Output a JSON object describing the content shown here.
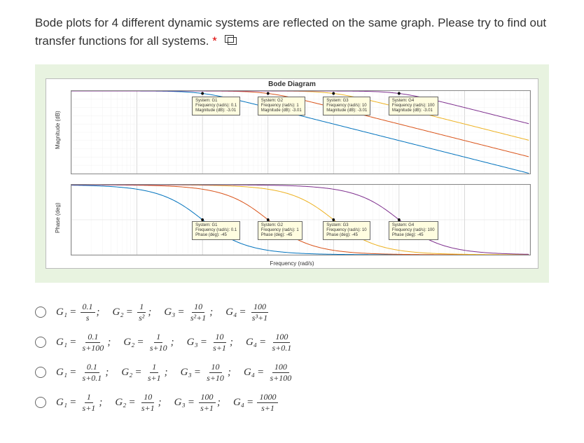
{
  "question": {
    "text": "Bode plots for 4 different dynamic systems are reflected on the same graph. Please try to find out transfer functions for all systems.",
    "required_mark": "*"
  },
  "chart_data": {
    "type": "line",
    "title": "Bode Diagram",
    "xlabel": "Frequency (rad/s)",
    "xscale": "log",
    "xrange": [
      0.001,
      10000
    ],
    "subplots": [
      {
        "ylabel": "Magnitude (dB)",
        "ylim": [
          -100,
          0
        ],
        "yticks": [
          -10,
          -20,
          -30,
          -40,
          -50,
          -60,
          -70,
          -80,
          -90,
          -100
        ],
        "series": [
          {
            "name": "G1",
            "color": "#0072bd",
            "break_freq": 0.1
          },
          {
            "name": "G2",
            "color": "#d95319",
            "break_freq": 1
          },
          {
            "name": "G3",
            "color": "#edb120",
            "break_freq": 10
          },
          {
            "name": "G4",
            "color": "#7e2f8e",
            "break_freq": 100
          }
        ],
        "tooltips": [
          {
            "system": "G1",
            "freq": "0.1",
            "mag": "-3.01"
          },
          {
            "system": "G2",
            "freq": "1",
            "mag": "-3.01"
          },
          {
            "system": "G3",
            "freq": "10",
            "mag": "-3.01"
          },
          {
            "system": "G4",
            "freq": "100",
            "mag": "-3.01"
          }
        ]
      },
      {
        "ylabel": "Phase (deg)",
        "ylim": [
          -90,
          0
        ],
        "yticks": [
          0,
          -45,
          -90
        ],
        "series": [
          {
            "name": "G1",
            "color": "#0072bd",
            "break_freq": 0.1
          },
          {
            "name": "G2",
            "color": "#d95319",
            "break_freq": 1
          },
          {
            "name": "G3",
            "color": "#edb120",
            "break_freq": 10
          },
          {
            "name": "G4",
            "color": "#7e2f8e",
            "break_freq": 100
          }
        ],
        "tooltips": [
          {
            "system": "G1",
            "freq": "0.1",
            "phase": "-45"
          },
          {
            "system": "G2",
            "freq": "1",
            "phase": "-45"
          },
          {
            "system": "G3",
            "freq": "10",
            "phase": "-45"
          },
          {
            "system": "G4",
            "freq": "100",
            "phase": "-45"
          }
        ]
      }
    ]
  },
  "options": [
    {
      "terms": [
        {
          "label": "G₁",
          "num": "0.1",
          "den": "s"
        },
        {
          "label": "G₂",
          "num": "1",
          "den": "s²"
        },
        {
          "label": "G₃",
          "num": "10",
          "den": "s²+1"
        },
        {
          "label": "G₄",
          "num": "100",
          "den": "s³+1"
        }
      ]
    },
    {
      "terms": [
        {
          "label": "G₁",
          "num": "0.1",
          "den": "s+100"
        },
        {
          "label": "G₂",
          "num": "1",
          "den": "s+10"
        },
        {
          "label": "G₃",
          "num": "10",
          "den": "s+1"
        },
        {
          "label": "G₄",
          "num": "100",
          "den": "s+0.1"
        }
      ]
    },
    {
      "terms": [
        {
          "label": "G₁",
          "num": "0.1",
          "den": "s+0.1"
        },
        {
          "label": "G₂",
          "num": "1",
          "den": "s+1"
        },
        {
          "label": "G₃",
          "num": "10",
          "den": "s+10"
        },
        {
          "label": "G₄",
          "num": "100",
          "den": "s+100"
        }
      ]
    },
    {
      "terms": [
        {
          "label": "G₁",
          "num": "1",
          "den": "s+1"
        },
        {
          "label": "G₂",
          "num": "10",
          "den": "s+1"
        },
        {
          "label": "G₃",
          "num": "100",
          "den": "s+1"
        },
        {
          "label": "G₄",
          "num": "1000",
          "den": "s+1"
        }
      ]
    }
  ]
}
